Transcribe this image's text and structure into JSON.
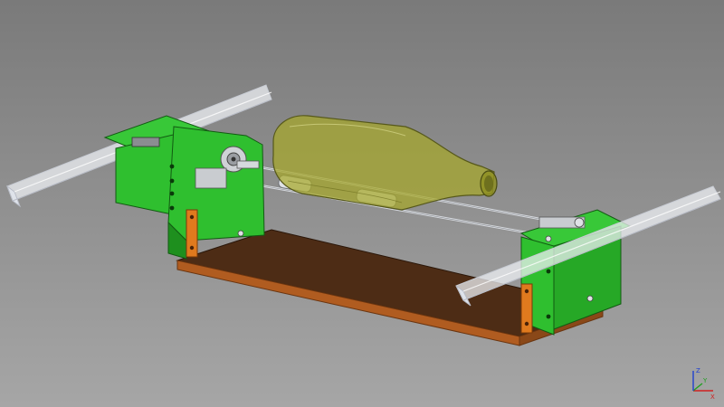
{
  "viewport": {
    "background_top": "#7a7a7a",
    "background_bottom": "#a6a6a6"
  },
  "model": {
    "parts": [
      "left-rail",
      "right-rail",
      "left-motor-bracket",
      "right-support-bracket",
      "wooden-base",
      "bottle",
      "rollers",
      "guide-rods",
      "orange-standoffs"
    ],
    "colors": {
      "bracket_green": "#2fbf2f",
      "bracket_green_dark": "#1e8f1e",
      "base_brown": "#4a2a14",
      "base_edge": "#a0521c",
      "standoff_orange": "#e07a1e",
      "bottle_olive": "#a6a82a",
      "rail_grey": "#e4e6ea"
    }
  },
  "axis": {
    "x_label": "X",
    "y_label": "Y",
    "z_label": "Z",
    "x_color": "#d02020",
    "y_color": "#20a020",
    "z_color": "#2040d0"
  }
}
